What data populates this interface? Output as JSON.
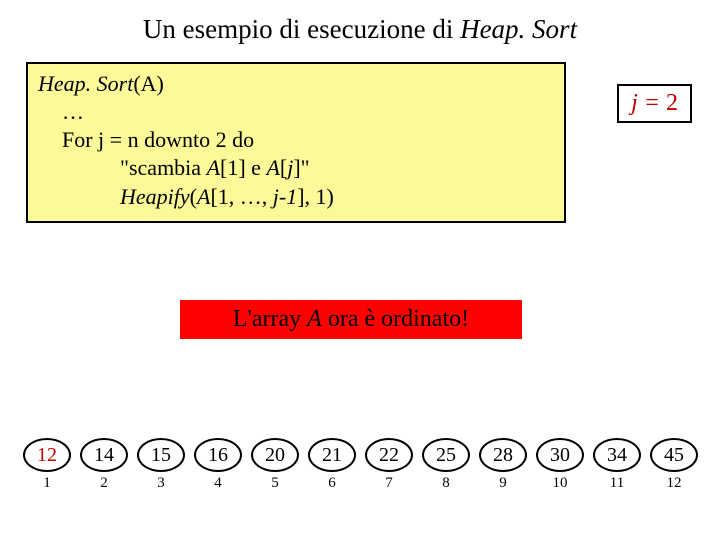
{
  "title_pre": "Un esempio di esecuzione di ",
  "title_ital": "Heap. Sort",
  "code": {
    "l1a": "Heap. Sort",
    "l1b": "(A)",
    "l2": "…",
    "l3": "For j  = n downto 2 do",
    "l4a": "\"scambia ",
    "l4b": "A",
    "l4c": "[1] e ",
    "l4d": "A",
    "l4e": "[",
    "l4f": "j",
    "l4g": "]\"",
    "l5a": "Heapify",
    "l5b": "(",
    "l5c": "A",
    "l5d": "[1, …, ",
    "l5e": "j-1",
    "l5f": "], 1)"
  },
  "jlabel": {
    "pre": "j = ",
    "val": "2"
  },
  "banner": {
    "a": "L'array ",
    "b": "A",
    "c": " ora è ordinato!"
  },
  "cells": [
    {
      "v": "12",
      "i": "1",
      "red": true
    },
    {
      "v": "14",
      "i": "2",
      "red": false
    },
    {
      "v": "15",
      "i": "3",
      "red": false
    },
    {
      "v": "16",
      "i": "4",
      "red": false
    },
    {
      "v": "20",
      "i": "5",
      "red": false
    },
    {
      "v": "21",
      "i": "6",
      "red": false
    },
    {
      "v": "22",
      "i": "7",
      "red": false
    },
    {
      "v": "25",
      "i": "8",
      "red": false
    },
    {
      "v": "28",
      "i": "9",
      "red": false
    },
    {
      "v": "30",
      "i": "10",
      "red": false
    },
    {
      "v": "34",
      "i": "11",
      "red": false
    },
    {
      "v": "45",
      "i": "12",
      "red": false
    }
  ]
}
